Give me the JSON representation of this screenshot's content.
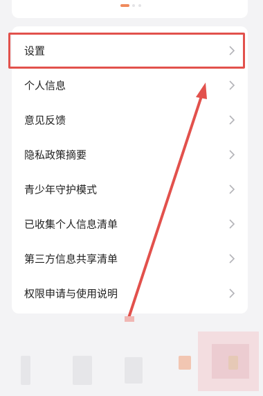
{
  "menu": {
    "items": [
      {
        "label": "设置"
      },
      {
        "label": "个人信息"
      },
      {
        "label": "意见反馈"
      },
      {
        "label": "隐私政策摘要"
      },
      {
        "label": "青少年守护模式"
      },
      {
        "label": "已收集个人信息清单"
      },
      {
        "label": "第三方信息共享清单"
      },
      {
        "label": "权限申请与使用说明"
      }
    ],
    "chevron_icon": "chevron-right-icon"
  },
  "carousel": {
    "active_index": 1,
    "count": 3
  },
  "colors": {
    "accent": "#f08a5d",
    "highlight": "#e2514c",
    "background": "#f3f3f5",
    "card": "#ffffff"
  }
}
